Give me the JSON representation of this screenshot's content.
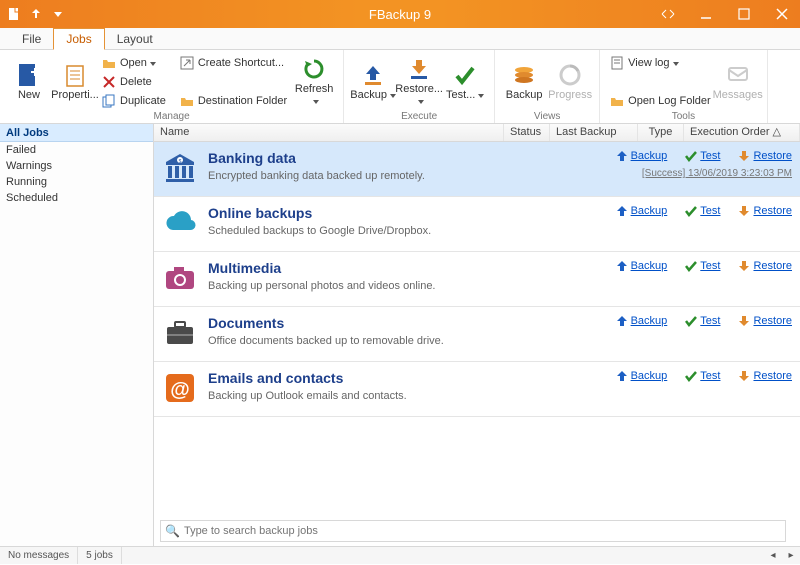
{
  "app_title": "FBackup 9",
  "tabs": [
    "File",
    "Jobs",
    "Layout"
  ],
  "active_tab": 1,
  "ribbon": {
    "new": "New",
    "properties": "Properti...",
    "open": "Open",
    "delete": "Delete",
    "duplicate": "Duplicate",
    "create_shortcut": "Create Shortcut...",
    "dest_folder": "Destination Folder",
    "refresh": "Refresh",
    "backup": "Backup",
    "restore": "Restore...",
    "test": "Test...",
    "viewbackup": "Backup",
    "progress": "Progress",
    "viewlog": "View log",
    "openlogfolder": "Open Log Folder",
    "messages": "Messages",
    "group_manage": "Manage",
    "group_execute": "Execute",
    "group_views": "Views",
    "group_tools": "Tools"
  },
  "sidebar": {
    "header": "All Jobs",
    "items": [
      "Failed",
      "Warnings",
      "Running",
      "Scheduled"
    ]
  },
  "columns": {
    "name": "Name",
    "status": "Status",
    "date": "Last Backup Date",
    "type": "Type",
    "exec": "Execution Order"
  },
  "jobs": [
    {
      "title": "Banking data",
      "desc": "Encrypted banking data backed up remotely.",
      "color": "#2f5fa8",
      "icon": "bank",
      "selected": true,
      "sub": "[Success] 13/06/2019 3:23:03 PM"
    },
    {
      "title": "Online backups",
      "desc": "Scheduled backups to Google Drive/Dropbox.",
      "color": "#2aa0c6",
      "icon": "cloud"
    },
    {
      "title": "Multimedia",
      "desc": "Backing up personal photos and videos online.",
      "color": "#b04780",
      "icon": "camera"
    },
    {
      "title": "Documents",
      "desc": "Office documents backed up to removable drive.",
      "color": "#4a4a4a",
      "icon": "briefcase"
    },
    {
      "title": "Emails and contacts",
      "desc": "Backing up Outlook emails and contacts.",
      "color": "#e56b1c",
      "icon": "at"
    }
  ],
  "actions": {
    "backup": "Backup",
    "test": "Test",
    "restore": "Restore"
  },
  "search_placeholder": "Type to search backup jobs",
  "status": {
    "msgs": "No messages",
    "jobs": "5 jobs"
  }
}
